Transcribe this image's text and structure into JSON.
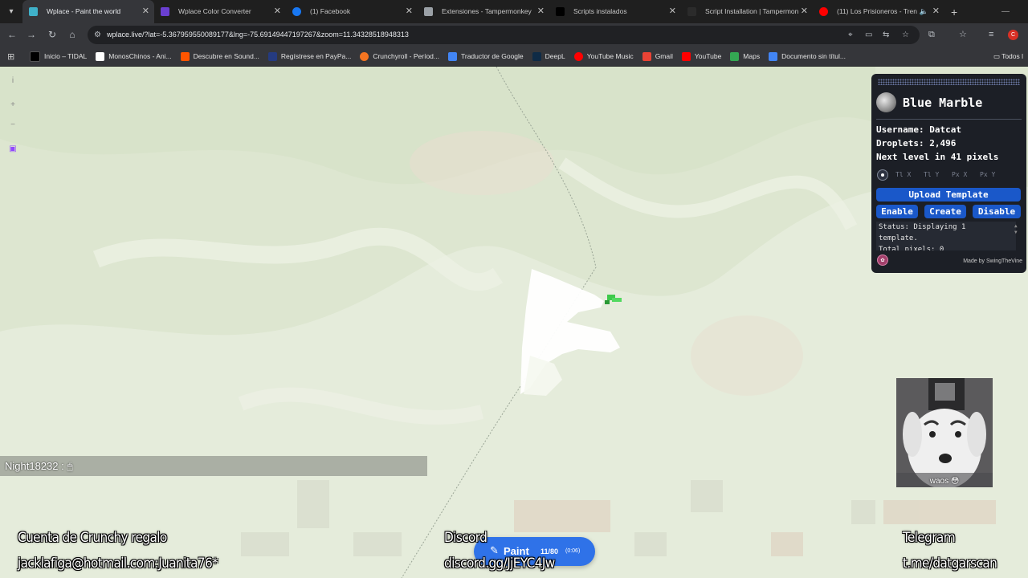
{
  "browser": {
    "tabs": [
      {
        "title": "Wplace - Paint the world",
        "active": true,
        "favicon_color": "#3fb1c9"
      },
      {
        "title": "Wplace Color Converter",
        "active": false,
        "favicon_color": "#6a3fd1"
      },
      {
        "title": "(1) Facebook",
        "active": false,
        "favicon_color": "#1877f2"
      },
      {
        "title": "Extensiones - Tampermonkey",
        "active": false,
        "favicon_color": "#9aa0a6"
      },
      {
        "title": "Scripts instalados",
        "active": false,
        "favicon_color": "#000000"
      },
      {
        "title": "Script Installation | Tampermon",
        "active": false,
        "favicon_color": "#2b2b2b"
      },
      {
        "title": "(11) Los Prisioneros - Tren",
        "active": false,
        "favicon_color": "#ff0000",
        "muted": true
      }
    ],
    "url": "wplace.live/?lat=-5.367959550089177&lng=-75.69149447197267&zoom=11.34328518948313",
    "profile_initial": "C",
    "bookmarks": [
      {
        "label": "Inicio – TIDAL",
        "favicon_color": "#000000"
      },
      {
        "label": "MonosChinos - Ani...",
        "favicon_color": "#ffffff"
      },
      {
        "label": "Descubre en Sound...",
        "favicon_color": "#ff5500"
      },
      {
        "label": "Regístrese en PayPa...",
        "favicon_color": "#253b80"
      },
      {
        "label": "Crunchyroll - Períod...",
        "favicon_color": "#f47521"
      },
      {
        "label": "Traductor de Google",
        "favicon_color": "#4285f4"
      },
      {
        "label": "DeepL",
        "favicon_color": "#0f2b46"
      },
      {
        "label": "YouTube Music",
        "favicon_color": "#ff0000"
      },
      {
        "label": "Gmail",
        "favicon_color": "#ea4335"
      },
      {
        "label": "YouTube",
        "favicon_color": "#ff0000"
      },
      {
        "label": "Maps",
        "favicon_color": "#34a853"
      },
      {
        "label": "Documento sin títul...",
        "favicon_color": "#4285f4"
      }
    ],
    "all_bookmarks": "Todos l"
  },
  "map": {
    "chat_user": "Night18232 :",
    "paint_button": {
      "label": "Paint",
      "count": "11/80",
      "timer": "(0:06)"
    }
  },
  "blue_marble": {
    "title": "Blue Marble",
    "username_label": "Username:",
    "username": "Datcat",
    "droplets_label": "Droplets:",
    "droplets": "2,496",
    "next_level_pre": "Next level in",
    "next_level_value": "41",
    "next_level_post": "pixels",
    "coord_placeholders": [
      "Tl X",
      "Tl Y",
      "Px X",
      "Px Y"
    ],
    "upload_label": "Upload Template",
    "enable_label": "Enable",
    "create_label": "Create",
    "disable_label": "Disable",
    "status_line1": "Status: Displaying 1",
    "status_line2": "template.",
    "status_line3": "Total pixels: 0",
    "made_by": "Made by SwingTheVine"
  },
  "webcam": {
    "caption": "waos 😳"
  },
  "overlays": {
    "crunchy_title": "Cuenta de Crunchy regalo",
    "crunchy_creds": "jacklafiga@hotmail.com:Juanita76*",
    "discord_title": "Discord",
    "discord_link": "discord.gg/JjEYC4Jw",
    "telegram_title": "Telegram",
    "telegram_link": "t.me/datgarscan"
  }
}
